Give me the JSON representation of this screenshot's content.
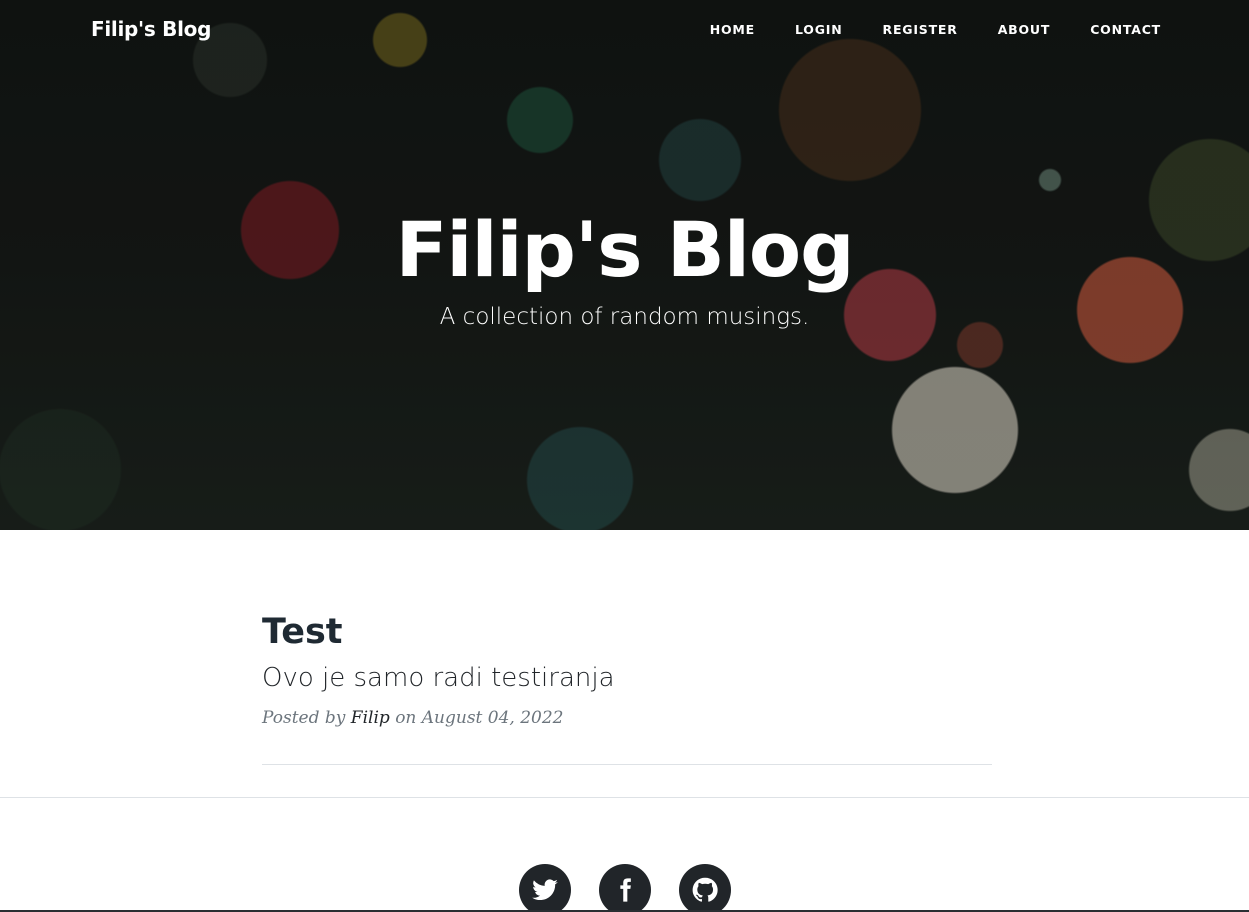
{
  "nav": {
    "brand": "Filip's Blog",
    "links": [
      "HOME",
      "LOGIN",
      "REGISTER",
      "ABOUT",
      "CONTACT"
    ]
  },
  "hero": {
    "title": "Filip's Blog",
    "subtitle": "A collection of random musings."
  },
  "post": {
    "title": "Test",
    "subtitle": "Ovo je samo radi testiranja",
    "meta_prefix": "Posted by",
    "author": "Filip",
    "meta_on": "on",
    "date": "August 04, 2022"
  },
  "footer": {
    "social_icons": [
      "twitter-icon",
      "facebook-icon",
      "github-icon"
    ]
  },
  "colors": {
    "dark": "#212529",
    "muted": "#6c757d",
    "white": "#ffffff"
  }
}
